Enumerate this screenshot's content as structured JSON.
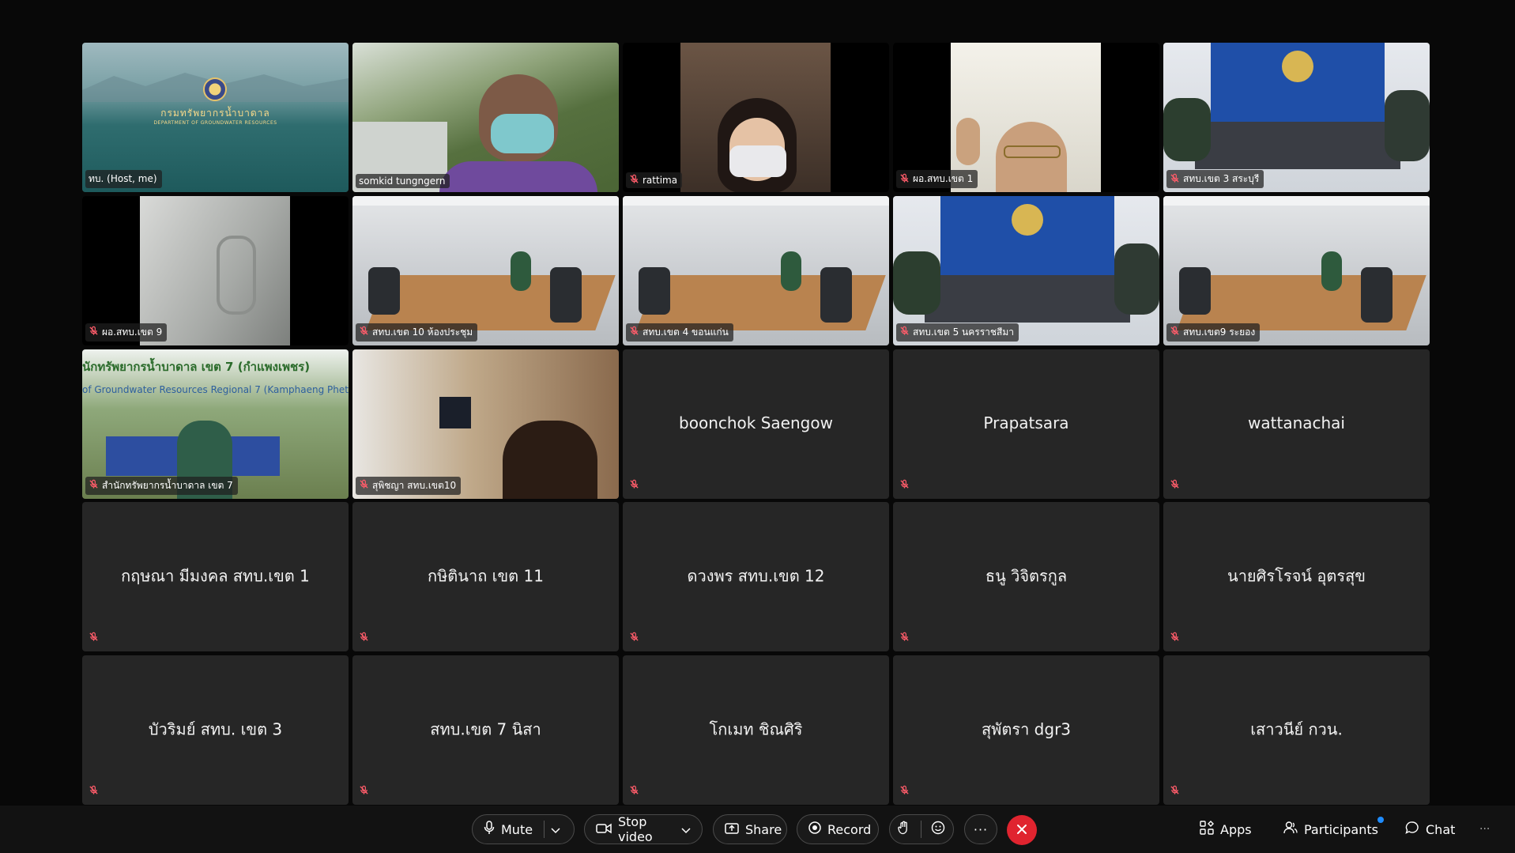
{
  "participants": [
    {
      "name": "ทบ. (Host, me)",
      "video": "logo",
      "muted": false
    },
    {
      "name": "somkid tungngern",
      "video": "outdoor-mask",
      "muted": false
    },
    {
      "name": "rattima",
      "video": "woman-mask",
      "muted": true
    },
    {
      "name": "ผอ.สทบ.เขต 1",
      "video": "man-glasses",
      "muted": true
    },
    {
      "name": "สทบ.เขต 3 สระบุรี",
      "video": "meeting-blue",
      "muted": true
    },
    {
      "name": "ผอ.สทบ.เขต 9",
      "video": "car-interior",
      "muted": true
    },
    {
      "name": "สทบ.เขต 10 ห้องประชุม",
      "video": "meeting-room",
      "muted": true
    },
    {
      "name": "สทบ.เขต 4 ขอนแก่น",
      "video": "meeting-room-2",
      "muted": true
    },
    {
      "name": "สทบ.เขต 5 นครราชสีมา",
      "video": "meeting-blue-2",
      "muted": true
    },
    {
      "name": "สทบ.เขต9 ระยอง",
      "video": "meeting-room-3",
      "muted": true
    },
    {
      "name": "สำนักทรัพยากรน้ำบาดาล เขต 7",
      "video": "banner",
      "muted": true,
      "banner_line1": "นักทรัพยากรน้ำบาดาล เขต 7 (กำแพงเพชร)",
      "banner_line2": "of Groundwater Resources Regional 7 (Kamphaeng Phet)"
    },
    {
      "name": "สุพิชญา สทบ.เขต10",
      "video": "home-office",
      "muted": true
    },
    {
      "name": "boonchok Saengow",
      "video": null,
      "muted": true
    },
    {
      "name": "Prapatsara",
      "video": null,
      "muted": true
    },
    {
      "name": "wattanachai",
      "video": null,
      "muted": true
    },
    {
      "name": "กฤษณา มีมงคล สทบ.เขต 1",
      "video": null,
      "muted": true
    },
    {
      "name": "กษิตินาถ เขต 11",
      "video": null,
      "muted": true
    },
    {
      "name": "ดวงพร สทบ.เขต 12",
      "video": null,
      "muted": true
    },
    {
      "name": "ธนู วิจิตรกูล",
      "video": null,
      "muted": true
    },
    {
      "name": "นายศิรโรจน์ อุตรสุข",
      "video": null,
      "muted": true
    },
    {
      "name": "บัวริมย์ สทบ. เขต 3",
      "video": null,
      "muted": true
    },
    {
      "name": "สทบ.เขต 7 นิสา",
      "video": null,
      "muted": true
    },
    {
      "name": "โกเมท ชิณศิริ",
      "video": null,
      "muted": true
    },
    {
      "name": "สุพัตรา dgr3",
      "video": null,
      "muted": true
    },
    {
      "name": "เสาวนีย์ กวน.",
      "video": null,
      "muted": true
    }
  ],
  "logo": {
    "title_th": "กรมทรัพยากรน้ำบาดาล",
    "title_en": "DEPARTMENT OF GROUNDWATER RESOURCES"
  },
  "toolbar": {
    "mute": "Mute",
    "stop_video": "Stop video",
    "share": "Share",
    "record": "Record",
    "apps": "Apps",
    "participants": "Participants",
    "chat": "Chat"
  },
  "colors": {
    "tile_bg": "#262626",
    "leave": "#e0242f",
    "badge": "#1f8cff",
    "mic_off": "#ff5c6a"
  }
}
